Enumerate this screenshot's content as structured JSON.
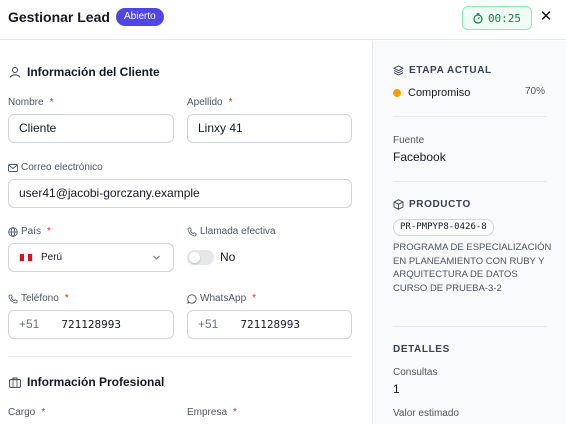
{
  "header": {
    "title": "Gestionar Lead",
    "status_badge": "Abierto",
    "timer": "00:25",
    "close_icon": "close-icon"
  },
  "client_section": {
    "title": "Información del Cliente",
    "icon": "user-icon",
    "fields": {
      "nombre": {
        "label": "Nombre",
        "required": "*",
        "value": "Cliente"
      },
      "apellido": {
        "label": "Apellido",
        "required": "*",
        "value": "Linxy 41"
      },
      "correo": {
        "label": "Correo electrónico",
        "icon": "mail-icon",
        "value": "user41@jacobi-gorczany.example"
      },
      "pais": {
        "label": "País",
        "required": "*",
        "icon": "globe-icon",
        "value": "Perú"
      },
      "llamada": {
        "label": "Llamada efectiva",
        "icon": "phone-call-icon",
        "value": "No"
      },
      "telefono": {
        "label": "Teléfono",
        "required": "*",
        "icon": "phone-icon",
        "prefix": "+51",
        "value": "721128993"
      },
      "whatsapp": {
        "label": "WhatsApp",
        "required": "*",
        "icon": "whatsapp-icon",
        "prefix": "+51",
        "value": "721128993"
      }
    }
  },
  "professional_section": {
    "title": "Información Profesional",
    "icon": "briefcase-icon",
    "fields": {
      "cargo": {
        "label": "Cargo",
        "required": "*"
      },
      "empresa": {
        "label": "Empresa",
        "required": "*"
      }
    }
  },
  "sidebar": {
    "stage": {
      "heading": "ETAPA ACTUAL",
      "icon": "layers-icon",
      "name": "Compromiso",
      "percent": "70%",
      "color": "#f59e0b"
    },
    "source": {
      "label": "Fuente",
      "value": "Facebook"
    },
    "product": {
      "heading": "PRODUCTO",
      "icon": "package-icon",
      "code": "PR-PMPYP8-0426-8",
      "name": "PROGRAMA DE ESPECIALIZACIÓN EN PLANEAMIENTO CON RUBY Y ARQUITECTURA DE DATOS CURSO DE PRUEBA-3-2"
    },
    "details": {
      "heading": "DETALLES",
      "consultas_label": "Consultas",
      "consultas_value": "1",
      "valor_label": "Valor estimado"
    }
  },
  "colors": {
    "badge": "#4f46e5",
    "timer_text": "#15803d",
    "timer_bg": "#f0fdf4",
    "required": "#dc2626"
  }
}
